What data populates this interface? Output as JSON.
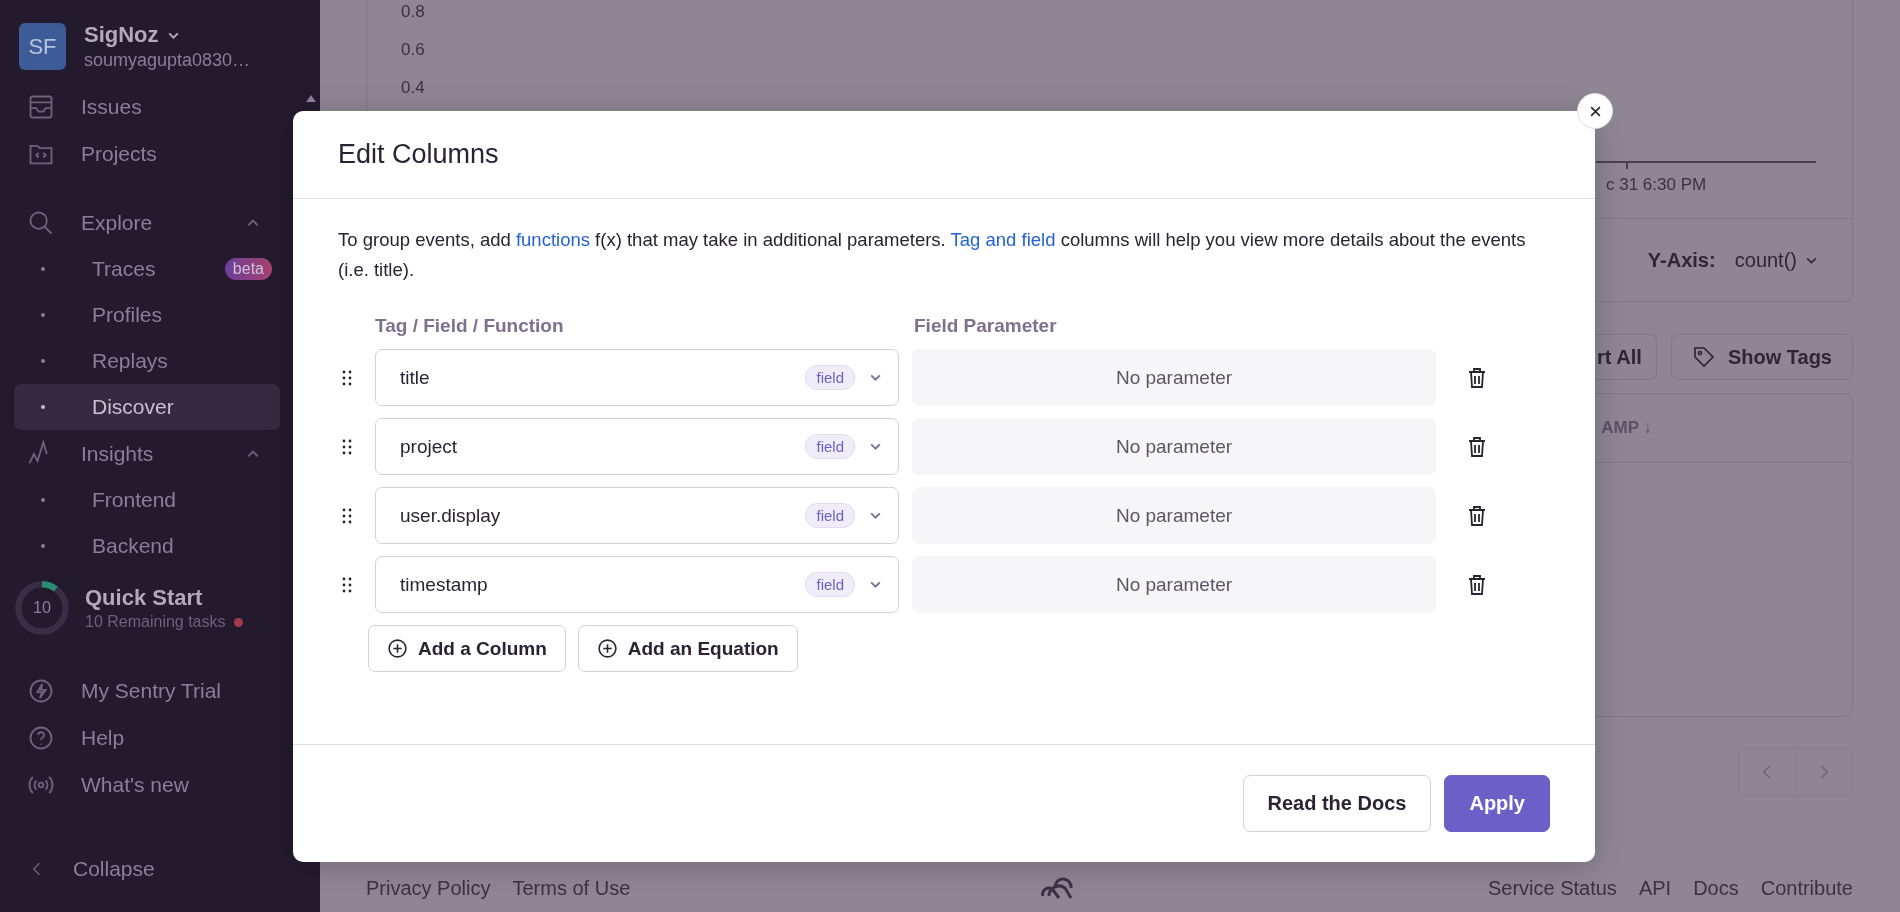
{
  "sidebar": {
    "org": {
      "initials": "SF",
      "name": "SigNoz",
      "account": "soumyagupta0830…"
    },
    "items": [
      {
        "kind": "nav",
        "label": "Issues"
      },
      {
        "kind": "nav",
        "label": "Projects"
      },
      {
        "kind": "section",
        "label": "Explore",
        "expanded": true,
        "children": [
          {
            "label": "Traces",
            "badge": "beta",
            "selected": false
          },
          {
            "label": "Profiles",
            "selected": false
          },
          {
            "label": "Replays",
            "selected": false
          },
          {
            "label": "Discover",
            "selected": true
          }
        ]
      },
      {
        "kind": "section",
        "label": "Insights",
        "expanded": true,
        "children": [
          {
            "label": "Frontend",
            "selected": false
          },
          {
            "label": "Backend",
            "selected": false
          }
        ]
      }
    ],
    "quick_start": {
      "count": "10",
      "title": "Quick Start",
      "subtitle": "10 Remaining tasks",
      "level": 0.1,
      "alert": true
    },
    "bottom_items": [
      {
        "label": "My Sentry Trial"
      },
      {
        "label": "Help"
      },
      {
        "label": "What's new"
      }
    ],
    "collapse": "Collapse"
  },
  "background": {
    "y_ticks": [
      "0.8",
      "0.6",
      "0.4"
    ],
    "x_tick": "c 31 6:30 PM",
    "y_axis": {
      "label": "Y-Axis:",
      "value": "count()"
    },
    "buttons": [
      "rt All",
      "Show Tags"
    ],
    "table_header": "AMP ↓",
    "footer": {
      "left": [
        "Privacy Policy",
        "Terms of Use"
      ],
      "right": [
        "Service Status",
        "API",
        "Docs",
        "Contribute"
      ]
    }
  },
  "modal": {
    "title": "Edit Columns",
    "description": [
      {
        "kind": "text",
        "text": "To group events, add "
      },
      {
        "kind": "link",
        "text": "functions"
      },
      {
        "kind": "text",
        "text": " f(x) that may take in additional parameters. "
      },
      {
        "kind": "link",
        "text": "Tag and field"
      },
      {
        "kind": "text",
        "text": " columns will help you view more details about the events (i.e. title)."
      }
    ],
    "columns": [
      "Tag / Field / Function",
      "Field Parameter"
    ],
    "rows": [
      {
        "value": "title",
        "badge": "field",
        "parameter": {
          "placeholder": "No parameter",
          "disabled": true
        }
      },
      {
        "value": "project",
        "badge": "field",
        "parameter": {
          "placeholder": "No parameter",
          "disabled": true
        }
      },
      {
        "value": "user.display",
        "badge": "field",
        "parameter": {
          "placeholder": "No parameter",
          "disabled": true
        }
      },
      {
        "value": "timestamp",
        "badge": "field",
        "parameter": {
          "placeholder": "No parameter",
          "disabled": true
        }
      }
    ],
    "add_buttons": [
      "Add a Column",
      "Add an Equation"
    ],
    "footer_buttons": [
      {
        "label": "Read the Docs",
        "kind": "secondary"
      },
      {
        "label": "Apply",
        "kind": "primary"
      }
    ]
  }
}
